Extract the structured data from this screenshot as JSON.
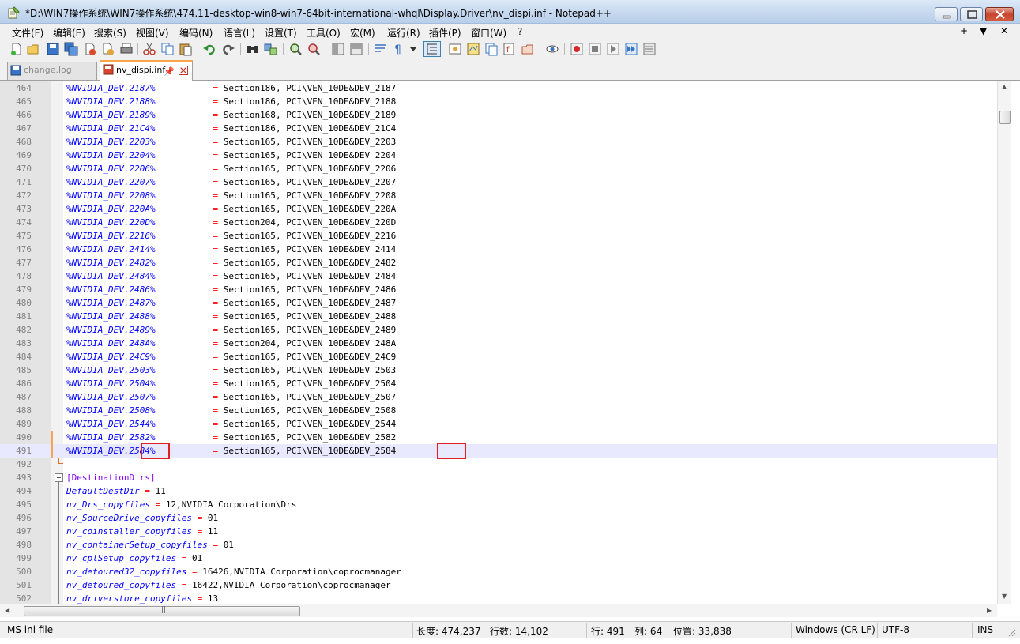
{
  "window": {
    "title": "*D:\\WIN7操作系统\\WIN7操作系统\\474.11-desktop-win8-win7-64bit-international-whql\\Display.Driver\\nv_dispi.inf - Notepad++"
  },
  "menu": [
    "文件(F)",
    "编辑(E)",
    "搜索(S)",
    "视图(V)",
    "编码(N)",
    "语言(L)",
    "设置(T)",
    "工具(O)",
    "宏(M)",
    "运行(R)",
    "插件(P)",
    "窗口(W)",
    "?"
  ],
  "menu_right": [
    "+",
    "▼",
    "✕"
  ],
  "tabs": [
    {
      "label": "change.log",
      "active": false
    },
    {
      "label": "nv_dispi.inf",
      "active": true
    }
  ],
  "tab_pin": "📌",
  "editor": {
    "lines": [
      {
        "n": "464",
        "dev": "%NVIDIA_DEV.2187%",
        "sec": "Section186",
        "pci": "PCI\\VEN_10DE&DEV_2187"
      },
      {
        "n": "465",
        "dev": "%NVIDIA_DEV.2188%",
        "sec": "Section186",
        "pci": "PCI\\VEN_10DE&DEV_2188"
      },
      {
        "n": "466",
        "dev": "%NVIDIA_DEV.2189%",
        "sec": "Section168",
        "pci": "PCI\\VEN_10DE&DEV_2189"
      },
      {
        "n": "467",
        "dev": "%NVIDIA_DEV.21C4%",
        "sec": "Section186",
        "pci": "PCI\\VEN_10DE&DEV_21C4"
      },
      {
        "n": "468",
        "dev": "%NVIDIA_DEV.2203%",
        "sec": "Section165",
        "pci": "PCI\\VEN_10DE&DEV_2203"
      },
      {
        "n": "469",
        "dev": "%NVIDIA_DEV.2204%",
        "sec": "Section165",
        "pci": "PCI\\VEN_10DE&DEV_2204"
      },
      {
        "n": "470",
        "dev": "%NVIDIA_DEV.2206%",
        "sec": "Section165",
        "pci": "PCI\\VEN_10DE&DEV_2206"
      },
      {
        "n": "471",
        "dev": "%NVIDIA_DEV.2207%",
        "sec": "Section165",
        "pci": "PCI\\VEN_10DE&DEV_2207"
      },
      {
        "n": "472",
        "dev": "%NVIDIA_DEV.2208%",
        "sec": "Section165",
        "pci": "PCI\\VEN_10DE&DEV_2208"
      },
      {
        "n": "473",
        "dev": "%NVIDIA_DEV.220A%",
        "sec": "Section165",
        "pci": "PCI\\VEN_10DE&DEV_220A"
      },
      {
        "n": "474",
        "dev": "%NVIDIA_DEV.220D%",
        "sec": "Section204",
        "pci": "PCI\\VEN_10DE&DEV_220D"
      },
      {
        "n": "475",
        "dev": "%NVIDIA_DEV.2216%",
        "sec": "Section165",
        "pci": "PCI\\VEN_10DE&DEV_2216"
      },
      {
        "n": "476",
        "dev": "%NVIDIA_DEV.2414%",
        "sec": "Section165",
        "pci": "PCI\\VEN_10DE&DEV_2414"
      },
      {
        "n": "477",
        "dev": "%NVIDIA_DEV.2482%",
        "sec": "Section165",
        "pci": "PCI\\VEN_10DE&DEV_2482"
      },
      {
        "n": "478",
        "dev": "%NVIDIA_DEV.2484%",
        "sec": "Section165",
        "pci": "PCI\\VEN_10DE&DEV_2484"
      },
      {
        "n": "479",
        "dev": "%NVIDIA_DEV.2486%",
        "sec": "Section165",
        "pci": "PCI\\VEN_10DE&DEV_2486"
      },
      {
        "n": "480",
        "dev": "%NVIDIA_DEV.2487%",
        "sec": "Section165",
        "pci": "PCI\\VEN_10DE&DEV_2487"
      },
      {
        "n": "481",
        "dev": "%NVIDIA_DEV.2488%",
        "sec": "Section165",
        "pci": "PCI\\VEN_10DE&DEV_2488"
      },
      {
        "n": "482",
        "dev": "%NVIDIA_DEV.2489%",
        "sec": "Section165",
        "pci": "PCI\\VEN_10DE&DEV_2489"
      },
      {
        "n": "483",
        "dev": "%NVIDIA_DEV.248A%",
        "sec": "Section204",
        "pci": "PCI\\VEN_10DE&DEV_248A"
      },
      {
        "n": "484",
        "dev": "%NVIDIA_DEV.24C9%",
        "sec": "Section165",
        "pci": "PCI\\VEN_10DE&DEV_24C9"
      },
      {
        "n": "485",
        "dev": "%NVIDIA_DEV.2503%",
        "sec": "Section165",
        "pci": "PCI\\VEN_10DE&DEV_2503"
      },
      {
        "n": "486",
        "dev": "%NVIDIA_DEV.2504%",
        "sec": "Section165",
        "pci": "PCI\\VEN_10DE&DEV_2504"
      },
      {
        "n": "487",
        "dev": "%NVIDIA_DEV.2507%",
        "sec": "Section165",
        "pci": "PCI\\VEN_10DE&DEV_2507"
      },
      {
        "n": "488",
        "dev": "%NVIDIA_DEV.2508%",
        "sec": "Section165",
        "pci": "PCI\\VEN_10DE&DEV_2508"
      },
      {
        "n": "489",
        "dev": "%NVIDIA_DEV.2544%",
        "sec": "Section165",
        "pci": "PCI\\VEN_10DE&DEV_2544"
      },
      {
        "n": "490",
        "dev": "%NVIDIA_DEV.2582%",
        "sec": "Section165",
        "pci": "PCI\\VEN_10DE&DEV_2582"
      },
      {
        "n": "491",
        "dev": "%NVIDIA_DEV.2584%",
        "sec": "Section165",
        "pci": "PCI\\VEN_10DE&DEV_2584"
      }
    ],
    "section_line": {
      "n": "493",
      "text": "[DestinationDirs]"
    },
    "kv_lines": [
      {
        "n": "494",
        "key": "DefaultDestDir",
        "val": "11"
      },
      {
        "n": "495",
        "key": "nv_Drs_copyfiles",
        "val": "12,NVIDIA Corporation\\Drs"
      },
      {
        "n": "496",
        "key": "nv_SourceDrive_copyfiles",
        "val": "01"
      },
      {
        "n": "497",
        "key": "nv_coinstaller_copyfiles",
        "val": "11"
      },
      {
        "n": "498",
        "key": "nv_containerSetup_copyfiles",
        "val": "01"
      },
      {
        "n": "499",
        "key": "nv_cplSetup_copyfiles",
        "val": "01"
      },
      {
        "n": "500",
        "key": "nv_detoured32_copyfiles",
        "val": "16426,NVIDIA Corporation\\coprocmanager"
      },
      {
        "n": "501",
        "key": "nv_detoured_copyfiles",
        "val": "16422,NVIDIA Corporation\\coprocmanager"
      },
      {
        "n": "502",
        "key": "nv_driverstore_copyfiles",
        "val": "13"
      }
    ],
    "blank_line": "492",
    "current_line": "491",
    "modified_lines": [
      "490",
      "491"
    ]
  },
  "statusbar": {
    "filetype": "MS ini file",
    "length": "长度: 474,237",
    "lines": "行数: 14,102",
    "ln": "行: 491",
    "col": "列: 64",
    "pos": "位置: 33,838",
    "eol": "Windows (CR LF)",
    "encoding": "UTF-8",
    "mode": "INS"
  },
  "colors": {
    "keyword": "#0000ff",
    "operator": "#ff0000",
    "section": "#8000ff",
    "highlight_box": "#e02020",
    "active_tab_accent": "#f9a64a"
  }
}
